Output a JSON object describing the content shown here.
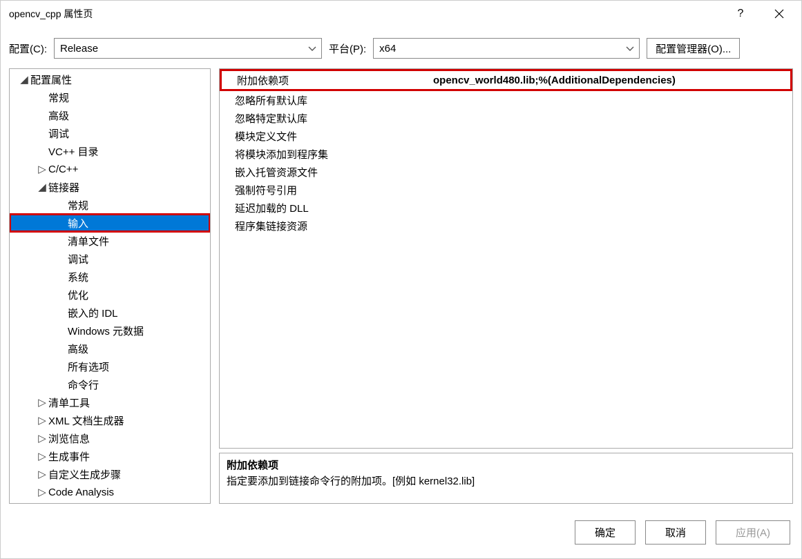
{
  "window": {
    "title": "opencv_cpp 属性页"
  },
  "toolbar": {
    "config_label": "配置(C):",
    "config_value": "Release",
    "platform_label": "平台(P):",
    "platform_value": "x64",
    "config_manager": "配置管理器(O)..."
  },
  "tree": {
    "root": "配置属性",
    "items_lvl2": {
      "general": "常规",
      "advanced": "高级",
      "debug": "调试",
      "vcpp_dirs": "VC++ 目录",
      "ccpp": "C/C++",
      "linker": "链接器",
      "manifest_tool": "清单工具",
      "xml_doc": "XML 文档生成器",
      "browse_info": "浏览信息",
      "build_events": "生成事件",
      "custom_build": "自定义生成步骤",
      "code_analysis": "Code Analysis"
    },
    "linker_children": {
      "general": "常规",
      "input": "输入",
      "manifest_file": "清单文件",
      "debug": "调试",
      "system": "系统",
      "optimize": "优化",
      "embedded_idl": "嵌入的 IDL",
      "win_metadata": "Windows 元数据",
      "advanced": "高级",
      "all_options": "所有选项",
      "cmdline": "命令行"
    }
  },
  "properties": {
    "rows": {
      "additional_deps": {
        "name": "附加依赖项",
        "value": "opencv_world480.lib;%(AdditionalDependencies)"
      },
      "ignore_all_default": {
        "name": "忽略所有默认库",
        "value": ""
      },
      "ignore_specific_default": {
        "name": "忽略特定默认库",
        "value": ""
      },
      "module_def": {
        "name": "模块定义文件",
        "value": ""
      },
      "add_module_to_asm": {
        "name": "将模块添加到程序集",
        "value": ""
      },
      "embed_managed_res": {
        "name": "嵌入托管资源文件",
        "value": ""
      },
      "force_symbol_ref": {
        "name": "强制符号引用",
        "value": ""
      },
      "delay_loaded_dll": {
        "name": "延迟加载的 DLL",
        "value": ""
      },
      "asm_link_res": {
        "name": "程序集链接资源",
        "value": ""
      }
    }
  },
  "description": {
    "title": "附加依赖项",
    "text": "指定要添加到链接命令行的附加项。[例如 kernel32.lib]"
  },
  "buttons": {
    "ok": "确定",
    "cancel": "取消",
    "apply": "应用(A)"
  }
}
